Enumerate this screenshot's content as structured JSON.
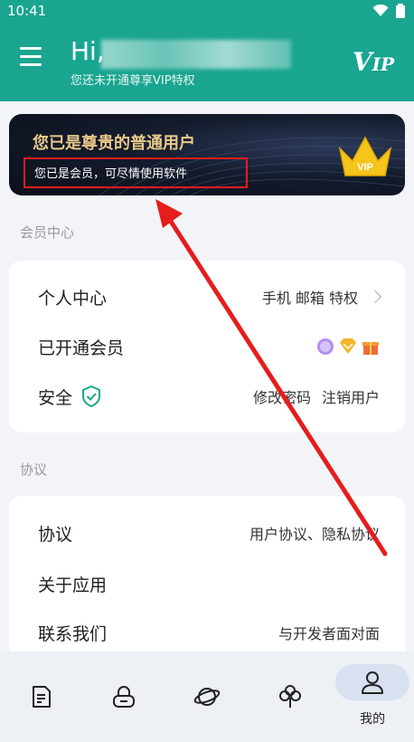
{
  "status_bar": {
    "time": "10:41"
  },
  "header": {
    "greeting": "Hi,",
    "subtitle": "您还未开通尊享VIP特权",
    "vip_logo_main": "V",
    "vip_logo_rest": "IP"
  },
  "vip_banner": {
    "title": "您已是尊贵的普通用户",
    "subtitle": "您已是会员，可尽情使用软件",
    "crown_text": "VIP"
  },
  "member_center": {
    "section_label": "会员中心",
    "rows": [
      {
        "label": "个人中心",
        "value": "手机 邮箱 特权"
      },
      {
        "label": "已开通会员",
        "value": ""
      },
      {
        "label": "安全",
        "value_a": "修改密码",
        "value_b": "注销用户"
      }
    ]
  },
  "agreement": {
    "section_label": "协议",
    "rows": [
      {
        "label": "协议",
        "value": "用户协议、隐私协议"
      },
      {
        "label": "关于应用",
        "value": ""
      },
      {
        "label": "联系我们",
        "value": "与开发者面对面"
      }
    ]
  },
  "bottom_nav": {
    "items": [
      {
        "icon": "document-icon",
        "label": ""
      },
      {
        "icon": "lock-icon",
        "label": ""
      },
      {
        "icon": "planet-icon",
        "label": ""
      },
      {
        "icon": "clover-icon",
        "label": ""
      },
      {
        "icon": "user-icon",
        "label": "我的"
      }
    ]
  },
  "colors": {
    "accent": "#1aa591",
    "annotation_red": "#e51d1d",
    "gold": "#e9c98a"
  }
}
